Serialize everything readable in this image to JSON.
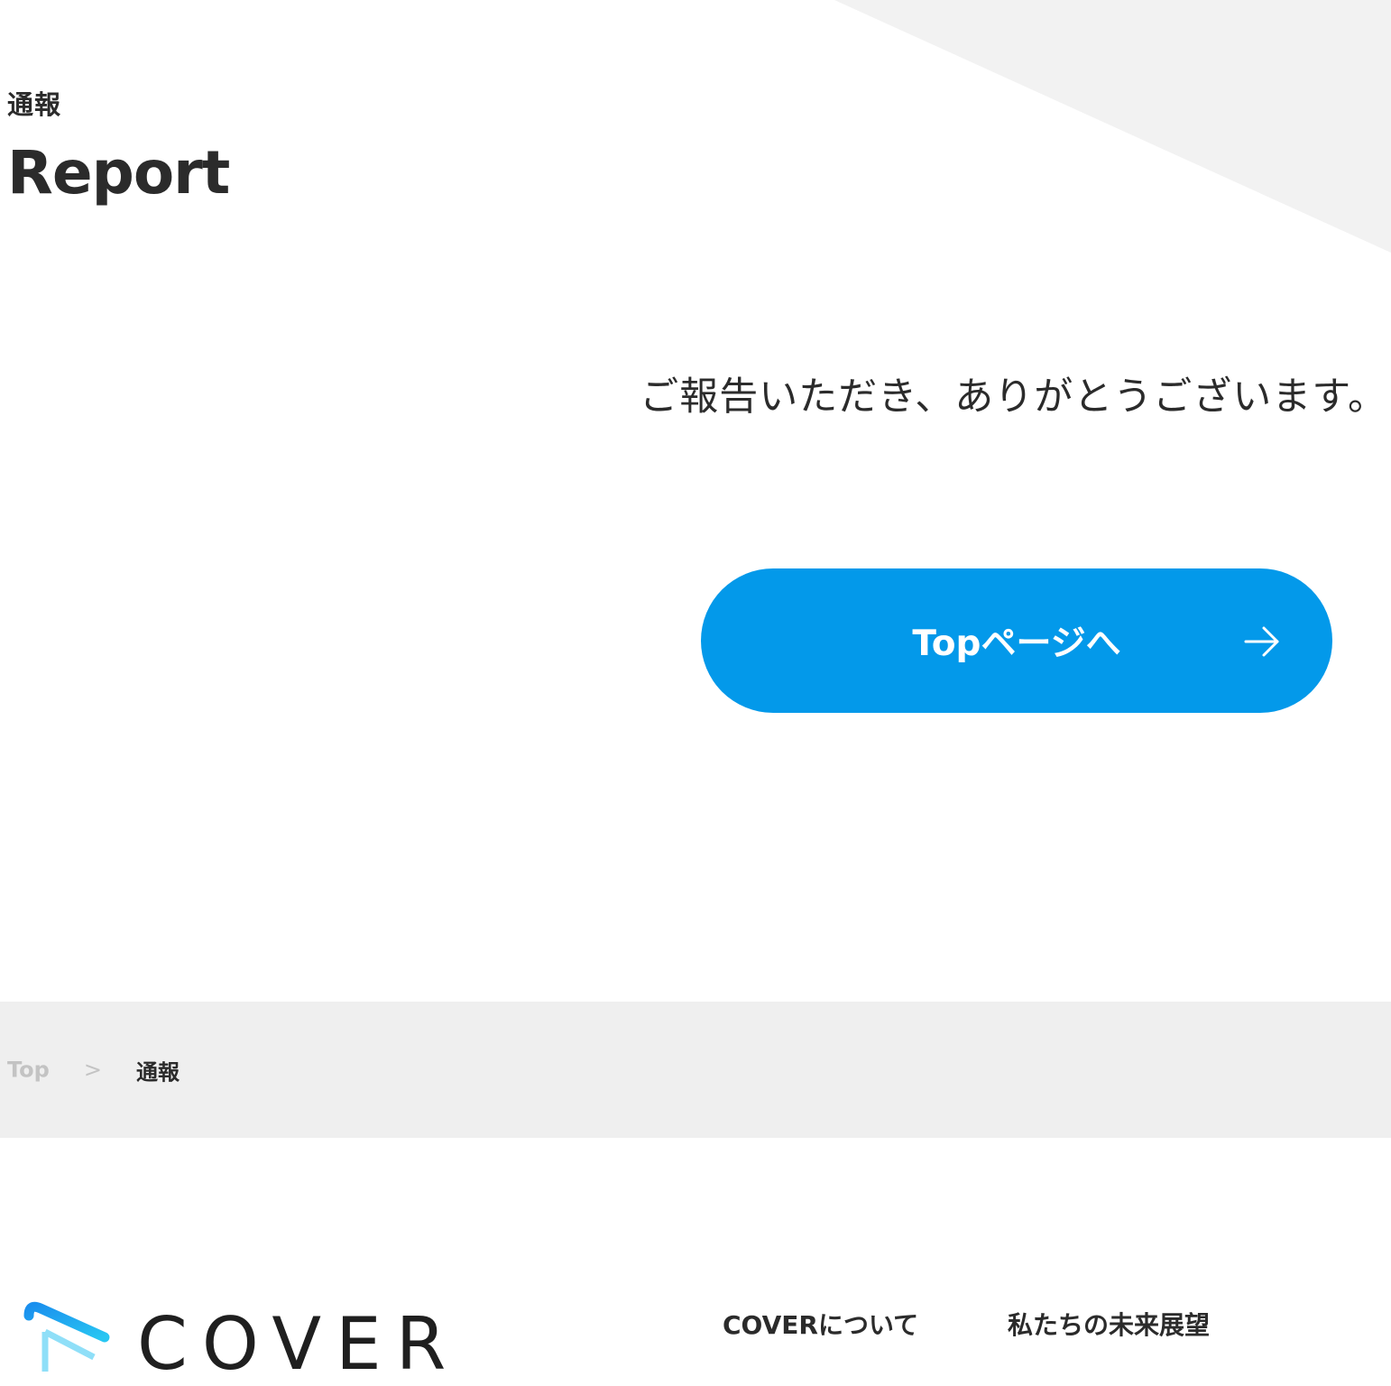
{
  "header": {
    "subtitle": "通報",
    "title": "Report"
  },
  "main": {
    "message": "ご報告いただき、ありがとうございます。",
    "top_button_label": "Topページへ"
  },
  "breadcrumb": {
    "home": "Top",
    "separator": ">",
    "current": "通報"
  },
  "footer": {
    "logo_text": "COVER",
    "links": [
      {
        "label": "COVERについて"
      },
      {
        "label": "私たちの未来展望"
      }
    ]
  },
  "colors": {
    "accent": "#0399ea",
    "text": "#2b2b2b",
    "breadcrumb_bg": "#efefef",
    "corner_shape": "#f2f2f2"
  },
  "icons": {
    "button_arrow": "arrow-right-icon",
    "logo_mark": "play-triangle-logo-icon"
  }
}
